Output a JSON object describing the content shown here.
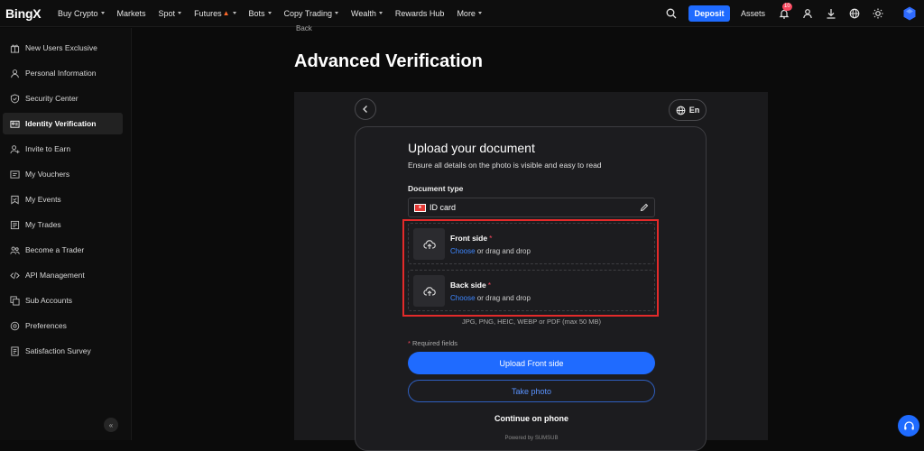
{
  "nav": {
    "logo": "BingX",
    "items": [
      {
        "label": "Buy Crypto",
        "caret": true
      },
      {
        "label": "Markets",
        "caret": false
      },
      {
        "label": "Spot",
        "caret": true
      },
      {
        "label": "Futures",
        "caret": true
      },
      {
        "label": "Bots",
        "caret": true
      },
      {
        "label": "Copy Trading",
        "caret": true
      },
      {
        "label": "Wealth",
        "caret": true
      },
      {
        "label": "Rewards Hub",
        "caret": false
      },
      {
        "label": "More",
        "caret": true
      }
    ],
    "deposit_label": "Deposit",
    "assets_label": "Assets",
    "notification_count": "10"
  },
  "sidebar": {
    "items": [
      {
        "label": "New Users Exclusive",
        "icon": "gift-icon"
      },
      {
        "label": "Personal Information",
        "icon": "user-icon"
      },
      {
        "label": "Security Center",
        "icon": "shield-icon"
      },
      {
        "label": "Identity Verification",
        "icon": "id-card-icon",
        "active": true
      },
      {
        "label": "Invite to Earn",
        "icon": "invite-icon"
      },
      {
        "label": "My Vouchers",
        "icon": "voucher-icon"
      },
      {
        "label": "My Events",
        "icon": "events-icon"
      },
      {
        "label": "My Trades",
        "icon": "trades-icon"
      },
      {
        "label": "Become a Trader",
        "icon": "trader-icon"
      },
      {
        "label": "API Management",
        "icon": "code-icon"
      },
      {
        "label": "Sub Accounts",
        "icon": "sub-accounts-icon"
      },
      {
        "label": "Preferences",
        "icon": "preferences-icon"
      },
      {
        "label": "Satisfaction Survey",
        "icon": "survey-icon"
      }
    ]
  },
  "main": {
    "back_label": "Back",
    "title": "Advanced Verification"
  },
  "verification": {
    "language": "En",
    "heading": "Upload your document",
    "subheading": "Ensure all details on the photo is visible and easy to read",
    "doc_type_label": "Document type",
    "doc_type_value": "ID card",
    "front": {
      "title": "Front side",
      "required_mark": "*",
      "choose": "Choose",
      "hint": " or drag and drop"
    },
    "back": {
      "title": "Back side",
      "required_mark": "*",
      "choose": "Choose",
      "hint": " or drag and drop"
    },
    "formats": "JPG, PNG, HEIC, WEBP or PDF (max 50 MB)",
    "required_mark": "*",
    "required_note": " Required fields",
    "upload_button": "Upload Front side",
    "photo_button": "Take photo",
    "phone_link": "Continue on phone",
    "powered_by": "Powered by SUMSUB"
  },
  "colors": {
    "accent": "#1f6bff",
    "highlight": "#e32a2a",
    "required": "#f6465d"
  }
}
